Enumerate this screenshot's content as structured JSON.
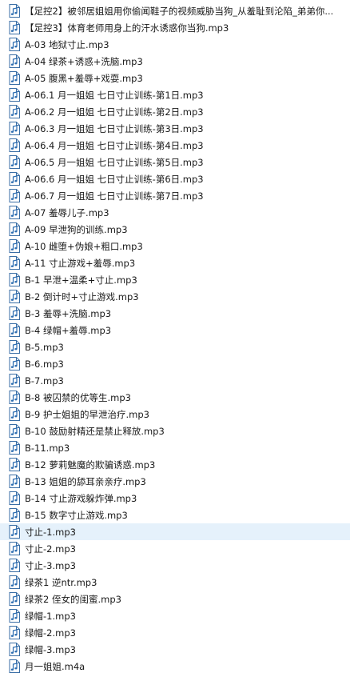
{
  "file_list": {
    "selected_index": 31,
    "icon": "audio-file-icon",
    "items": [
      "【足控2】被邻居姐姐用你偷闻鞋子的视频威胁当狗_从羞耻到沦陷_弟弟你...",
      "【足控3】体育老师用身上的汗水诱惑你当狗.mp3",
      "A-03 地狱寸止.mp3",
      "A-04 绿茶+诱惑+洗脑.mp3",
      "A-05 腹黑+羞辱+戏耍.mp3",
      "A-06.1 月一姐姐 七日寸止训练-第1日.mp3",
      "A-06.2 月一姐姐 七日寸止训练-第2日.mp3",
      "A-06.3 月一姐姐 七日寸止训练-第3日.mp3",
      "A-06.4 月一姐姐 七日寸止训练-第4日.mp3",
      "A-06.5 月一姐姐 七日寸止训练-第5日.mp3",
      "A-06.6 月一姐姐 七日寸止训练-第6日.mp3",
      "A-06.7 月一姐姐 七日寸止训练-第7日.mp3",
      "A-07 羞辱儿子.mp3",
      "A-09 早泄狗的训练.mp3",
      "A-10 雌堕+伪娘+粗口.mp3",
      "A-11 寸止游戏+羞辱.mp3",
      "B-1 早泄+温柔+寸止.mp3",
      "B-2 倒计时+寸止游戏.mp3",
      "B-3 羞辱+洗脑.mp3",
      "B-4 绿帽+羞辱.mp3",
      "B-5.mp3",
      "B-6.mp3",
      "B-7.mp3",
      "B-8 被囚禁的优等生.mp3",
      "B-9 护士姐姐的早泄治疗.mp3",
      "B-10 鼓励射精还是禁止释放.mp3",
      "B-11.mp3",
      "B-12 萝莉魅魔的欺骗诱惑.mp3",
      "B-13 姐姐的舔耳亲亲疗.mp3",
      "B-14 寸止游戏躲炸弹.mp3",
      "B-15 数字寸止游戏.mp3",
      "寸止-1.mp3",
      "寸止-2.mp3",
      "寸止-3.mp3",
      "绿茶1 逆ntr.mp3",
      "绿茶2 侄女的闺蜜.mp3",
      "绿帽-1.mp3",
      "绿帽-2.mp3",
      "绿帽-3.mp3",
      "月一姐姐.m4a"
    ]
  },
  "colors": {
    "selected_row_bg": "#e5f1fb",
    "icon_body": "#ffffff",
    "icon_outline": "#3a6ea5",
    "icon_note": "#2b6cb0"
  }
}
